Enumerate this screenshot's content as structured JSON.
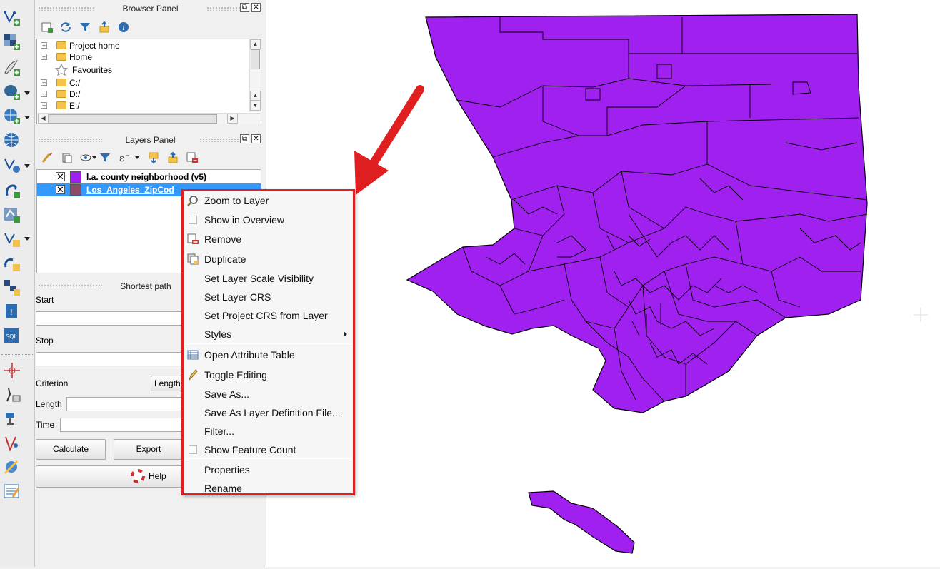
{
  "browser_panel": {
    "title": "Browser Panel",
    "items": [
      "Project home",
      "Home",
      "Favourites",
      "C:/",
      "D:/",
      "E:/"
    ]
  },
  "layers_panel": {
    "title": "Layers Panel",
    "layers": [
      {
        "name": "l.a. county neighborhood (v5)",
        "checked": "✕",
        "color": "#a020f0"
      },
      {
        "name": "Los_Angeles_ZipCod",
        "checked": "✕",
        "color": "#8b4c6a"
      }
    ]
  },
  "shortest_path": {
    "title": "Shortest path",
    "start_label": "Start",
    "stop_label": "Stop",
    "criterion_label": "Criterion",
    "criterion_value": "Length",
    "length_label": "Length",
    "time_label": "Time",
    "calculate": "Calculate",
    "export": "Export",
    "help": "Help"
  },
  "context_menu": {
    "items": [
      {
        "label": "Zoom to Layer",
        "icon": "zoom-icon"
      },
      {
        "label": "Show in Overview",
        "icon": "checkbox-icon"
      },
      {
        "label": "Remove",
        "icon": "remove-layer-icon"
      },
      {
        "label": "Duplicate",
        "icon": "duplicate-icon"
      },
      {
        "label": "Set Layer Scale Visibility",
        "icon": ""
      },
      {
        "label": "Set Layer CRS",
        "icon": ""
      },
      {
        "label": "Set Project CRS from Layer",
        "icon": ""
      },
      {
        "label": "Styles",
        "icon": "submenu-arrow-icon"
      },
      {
        "label": "Open Attribute Table",
        "icon": "table-icon"
      },
      {
        "label": "Toggle Editing",
        "icon": "pencil-icon"
      },
      {
        "label": "Save As...",
        "icon": ""
      },
      {
        "label": "Save As Layer Definition File...",
        "icon": ""
      },
      {
        "label": "Filter...",
        "icon": ""
      },
      {
        "label": "Show Feature Count",
        "icon": "checkbox-icon"
      },
      {
        "label": "Properties",
        "icon": ""
      },
      {
        "label": "Rename",
        "icon": ""
      }
    ]
  },
  "colors": {
    "map_fill": "#a020f0",
    "annotation_red": "#e02020",
    "selected_row": "#3399ff"
  }
}
